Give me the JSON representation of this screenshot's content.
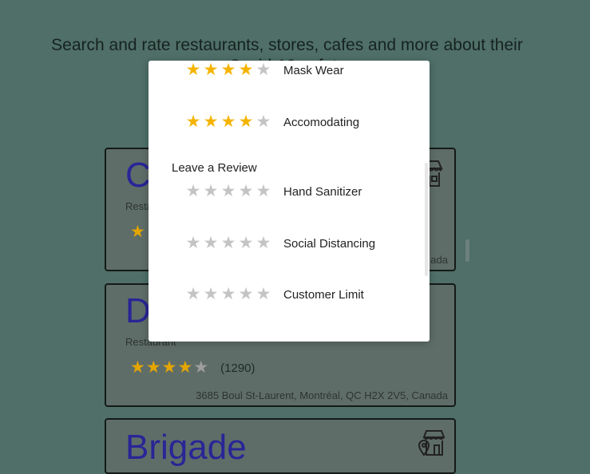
{
  "headline": {
    "line1": "Search and rate restaurants, stores, cafes and more about their",
    "line2": "Covid-19 safety"
  },
  "cards": [
    {
      "name": "C",
      "category": "Resta",
      "rating": 1,
      "count": "",
      "address": "ada",
      "icon": "storefront-icon"
    },
    {
      "name": "D",
      "category": "Restaurant",
      "rating": 4,
      "count": "(1290)",
      "address": "3685 Boul St-Laurent, Montréal, QC H2X 2V5, Canada",
      "icon": "storefront-icon"
    },
    {
      "name": "Brigade",
      "category": "",
      "rating": 0,
      "count": "",
      "address": "",
      "icon": "storefront-location-icon"
    }
  ],
  "modal": {
    "current_ratings": [
      {
        "label": "Mask Wear",
        "value": 4
      },
      {
        "label": "Accomodating",
        "value": 4
      }
    ],
    "review_title": "Leave a Review",
    "review_items": [
      {
        "label": "Hand Sanitizer",
        "value": 0
      },
      {
        "label": "Social Distancing",
        "value": 0
      },
      {
        "label": "Customer Limit",
        "value": 0
      }
    ]
  },
  "colors": {
    "background": "#4f6f68",
    "star_active": "#f5b400",
    "star_inactive": "#c4c4c4",
    "brand_text": "#2a2596"
  }
}
